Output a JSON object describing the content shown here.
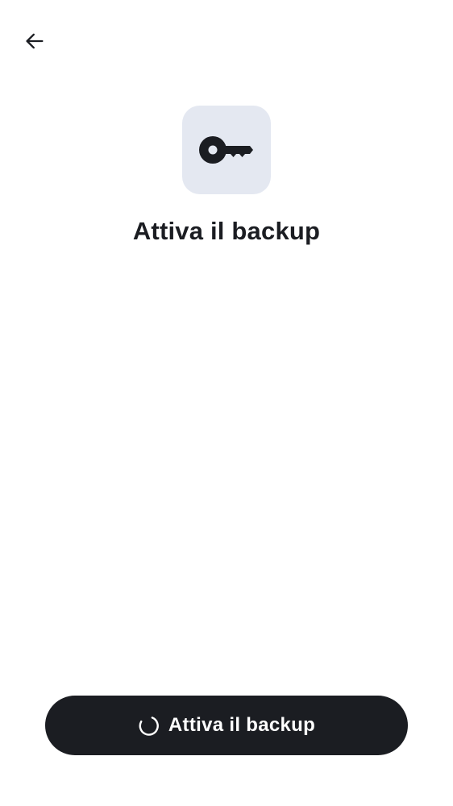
{
  "header": {
    "back_icon": "arrow-left-icon"
  },
  "hero": {
    "icon": "key-icon",
    "tile_color": "#e4e8f1",
    "title": "Attiva il backup"
  },
  "action": {
    "label": "Attiva il backup",
    "loading": true,
    "spinner_icon": "spinner-icon",
    "button_color": "#1b1d22"
  }
}
